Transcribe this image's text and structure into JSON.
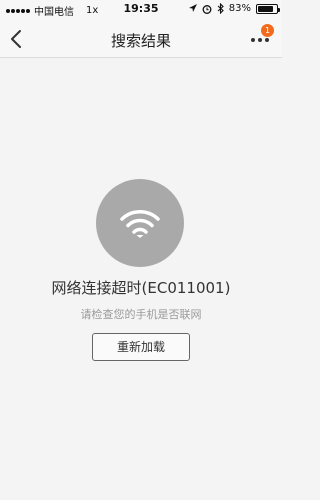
{
  "status_bar": {
    "carrier": "中国电信",
    "network": "1x",
    "time": "19:35",
    "battery_percent": "83%",
    "battery_level": 0.83
  },
  "nav": {
    "title": "搜索结果",
    "badge_count": "1",
    "badge_color": "#f26b1d"
  },
  "error": {
    "icon": "wifi-icon",
    "title": "网络连接超时(EC011001)",
    "hint": "请检查您的手机是否联网",
    "reload_label": "重新加载"
  }
}
